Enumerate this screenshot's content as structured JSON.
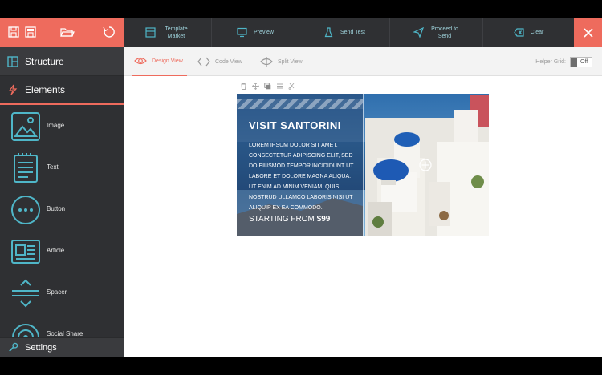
{
  "toolbar": {
    "template_market": "Template Market",
    "preview": "Preview",
    "send_test": "Send Test",
    "proceed": "Proceed to Send",
    "clear": "Clear"
  },
  "panels": {
    "structure": "Structure",
    "elements": "Elements",
    "settings": "Settings"
  },
  "elements": [
    {
      "label": "Image",
      "icon": "image-icon"
    },
    {
      "label": "Text",
      "icon": "text-icon"
    },
    {
      "label": "Button",
      "icon": "button-icon"
    },
    {
      "label": "Article",
      "icon": "article-icon"
    },
    {
      "label": "Spacer",
      "icon": "spacer-icon"
    },
    {
      "label": "Social Share",
      "icon": "social-share-icon"
    }
  ],
  "views": {
    "design": "Design View",
    "code": "Code View",
    "split": "Split View"
  },
  "helper_grid": {
    "label": "Helper Grid:",
    "state": "Off"
  },
  "banner": {
    "title": "VISIT SANTORINI",
    "body": "LOREM IPSUM DOLOR SIT AMET, CONSECTETUR ADIPISCING ELIT, SED DO EIUSMOD TEMPOR INCIDIDUNT UT LABORE ET DOLORE MAGNA ALIQUA. UT ENIM AD MINIM VENIAM, QUIS NOSTRUD ULLAMCO LABORIS NISI UT ALIQUIP EX EA COMMODO.",
    "price_prefix": "STARTING FROM",
    "price": "$99"
  },
  "colors": {
    "accent": "#ee6b5d",
    "icon_teal": "#4fb6c8",
    "sidebar": "#2f3033"
  }
}
